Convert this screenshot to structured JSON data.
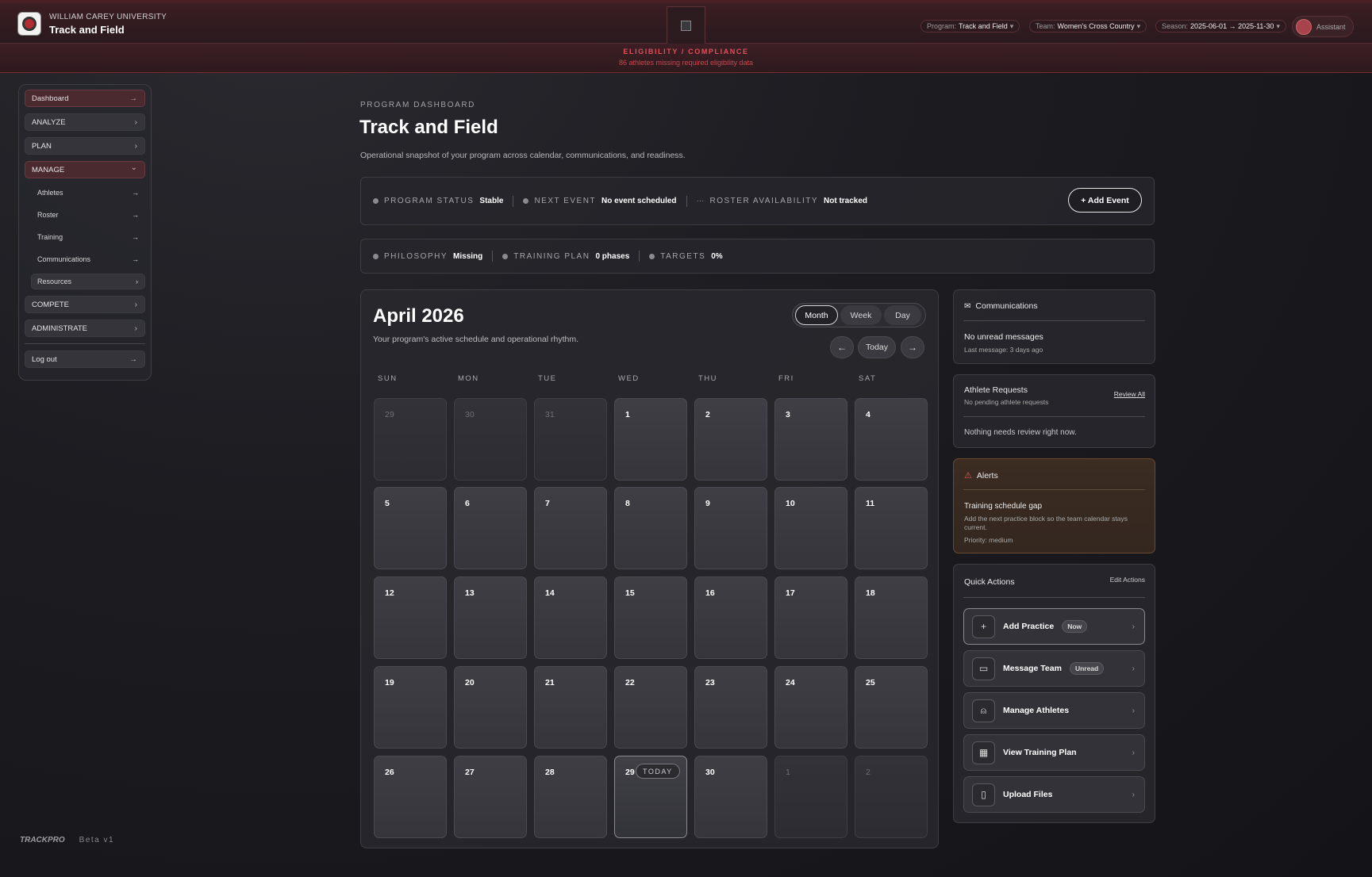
{
  "header": {
    "university": "WILLIAM CAREY UNIVERSITY",
    "app_title": "Track and Field",
    "program_label": "Program:",
    "program_value": "Track and Field",
    "team_label": "Team:",
    "team_value": "Women's Cross Country",
    "season_label": "Season:",
    "season_value": "2025-06-01 → 2025-11-30",
    "assistant_label": "Assistant"
  },
  "banner": {
    "title": "ELIGIBILITY / COMPLIANCE",
    "message": "86 athletes missing required eligibility data"
  },
  "sidebar": {
    "dashboard": "Dashboard",
    "analyze": "ANALYZE",
    "plan": "PLAN",
    "manage": "MANAGE",
    "athletes": "Athletes",
    "roster": "Roster",
    "training": "Training",
    "communications": "Communications",
    "resources": "Resources",
    "compete": "COMPETE",
    "administrate": "ADMINISTRATE",
    "logout": "Log out",
    "arrow": "→",
    "chev": "›",
    "chev_down": "⌄"
  },
  "footer": {
    "logo": "TRACKPRO",
    "version": "Beta v1"
  },
  "page": {
    "eyebrow": "PROGRAM DASHBOARD",
    "title": "Track and Field",
    "subtitle": "Operational snapshot of your program across calendar, communications, and readiness."
  },
  "status_bar": {
    "program_status_label": "PROGRAM STATUS",
    "program_status_value": "Stable",
    "next_event_label": "NEXT EVENT",
    "next_event_value": "No event scheduled",
    "roster_label": "ROSTER AVAILABILITY",
    "roster_value": "Not tracked",
    "add_event": "+ Add Event"
  },
  "readiness_bar": {
    "philosophy_label": "PHILOSOPHY",
    "philosophy_value": "Missing",
    "training_plan_label": "TRAINING PLAN",
    "training_plan_value": "0 phases",
    "targets_label": "TARGETS",
    "targets_value": "0%"
  },
  "calendar": {
    "title": "April 2026",
    "subtitle": "Your program's active schedule and operational rhythm.",
    "views": [
      "Month",
      "Week",
      "Day"
    ],
    "active_view": "Month",
    "prev": "←",
    "today": "Today",
    "next": "→",
    "weekdays": [
      "SUN",
      "MON",
      "TUE",
      "WED",
      "THU",
      "FRI",
      "SAT"
    ],
    "today_chip": "TODAY",
    "weeks": [
      [
        "29",
        "30",
        "31",
        "1",
        "2",
        "3",
        "4"
      ],
      [
        "5",
        "6",
        "7",
        "8",
        "9",
        "10",
        "11"
      ],
      [
        "12",
        "13",
        "14",
        "15",
        "16",
        "17",
        "18"
      ],
      [
        "19",
        "20",
        "21",
        "22",
        "23",
        "24",
        "25"
      ],
      [
        "26",
        "27",
        "28",
        "29",
        "30",
        "1",
        "2"
      ]
    ]
  },
  "communications": {
    "title": "Communications",
    "status": "No unread messages",
    "last": "Last message: 3 days ago"
  },
  "athlete_requests": {
    "title": "Athlete Requests",
    "subtitle": "No pending athlete requests",
    "review_all": "Review All",
    "empty": "Nothing needs review right now."
  },
  "alerts": {
    "title": "Alerts",
    "item_title": "Training schedule gap",
    "item_body": "Add the next practice block so the team calendar stays current.",
    "priority": "Priority: medium"
  },
  "quick_actions": {
    "title": "Quick Actions",
    "edit": "Edit Actions",
    "items": [
      {
        "label": "Add Practice",
        "badge": "Now",
        "icon": "plus-icon",
        "glyph": "+"
      },
      {
        "label": "Message Team",
        "badge": "Unread",
        "icon": "message-icon",
        "glyph": "▭"
      },
      {
        "label": "Manage Athletes",
        "badge": "",
        "icon": "person-icon",
        "glyph": "⍝"
      },
      {
        "label": "View Training Plan",
        "badge": "",
        "icon": "calendar-icon",
        "glyph": "▦"
      },
      {
        "label": "Upload Files",
        "badge": "",
        "icon": "file-icon",
        "glyph": "▯"
      }
    ],
    "chev": "›"
  },
  "colors": {
    "accent": "#b22b33",
    "alert_text": "#e0505a"
  }
}
